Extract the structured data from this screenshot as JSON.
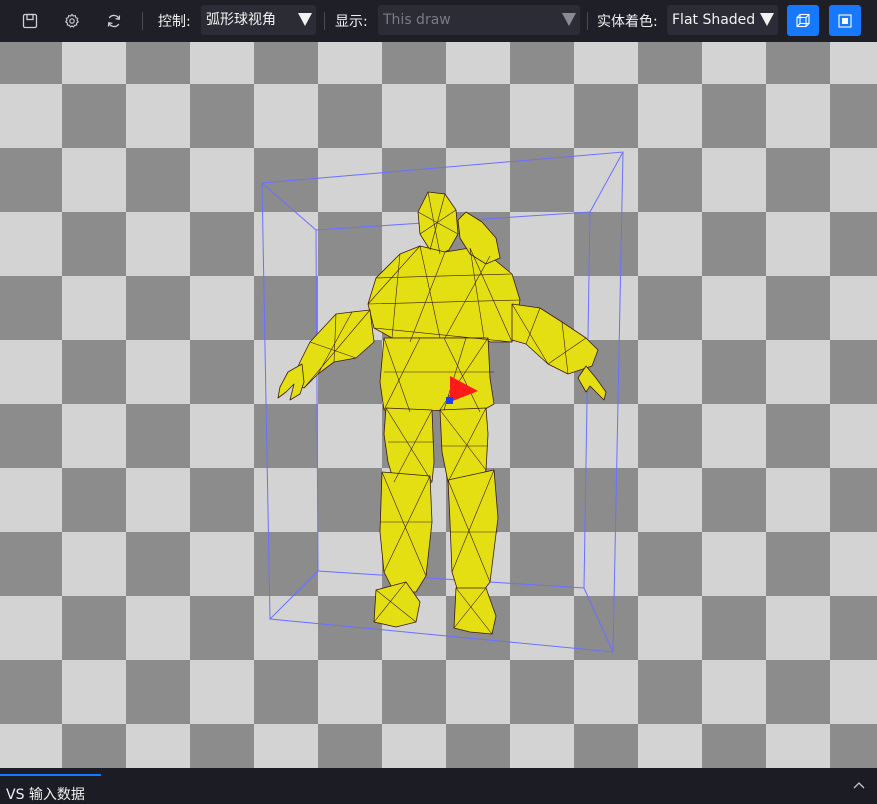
{
  "toolbar": {
    "control_label": "控制:",
    "control_value": "弧形球视角",
    "display_label": "显示:",
    "display_value": "This draw",
    "shading_label": "实体着色:",
    "shading_value": "Flat Shaded",
    "icons": [
      "save-icon",
      "gear-icon",
      "refresh-icon",
      "bounding-box-icon",
      "solid-square-icon"
    ]
  },
  "bottom": {
    "tab_label": "VS 输入数据"
  },
  "colors": {
    "accent": "#1677ff",
    "mesh_fill": "#e3df12",
    "mesh_wire": "#3a1a10",
    "bbox": "#6a70ff",
    "checker_light": "#d3d3d3",
    "checker_dark": "#8c8c8c"
  }
}
